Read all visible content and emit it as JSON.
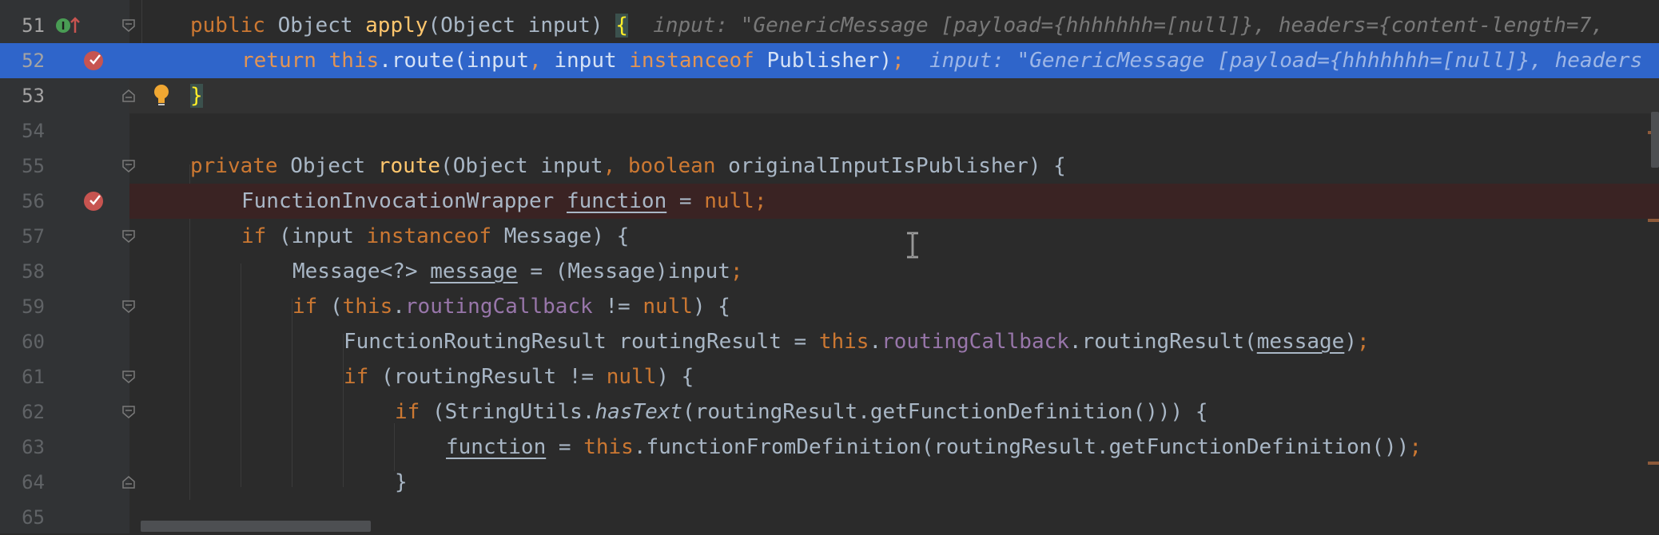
{
  "editor": {
    "lines": [
      {
        "number": "51"
      },
      {
        "number": "52"
      },
      {
        "number": "53"
      },
      {
        "number": "54"
      },
      {
        "number": "55"
      },
      {
        "number": "56"
      },
      {
        "number": "57"
      },
      {
        "number": "58"
      },
      {
        "number": "59"
      },
      {
        "number": "60"
      },
      {
        "number": "61"
      },
      {
        "number": "62"
      },
      {
        "number": "63"
      },
      {
        "number": "64"
      },
      {
        "number": "65"
      }
    ],
    "l51": {
      "kw_public": "public",
      "t_object": " Object ",
      "fn_apply": "apply",
      "t_params": "(Object input) ",
      "brace": "{",
      "hint": "input: \"GenericMessage [payload={hhhhhhh=[null]}, headers={content-length=7, "
    },
    "l52": {
      "kw_return": "return",
      "sp": " ",
      "kw_this": "this",
      "t_route": ".route(input",
      "comma": ",",
      "t_input": " input ",
      "kw_instanceof": "instanceof",
      "t_publisher": " Publisher)",
      "semi": ";",
      "hint": "input: \"GenericMessage [payload={hhhhhhh=[null]}, headers"
    },
    "l53": {
      "brace": "}"
    },
    "l55": {
      "kw_private": "private",
      "t_object": " Object ",
      "fn_route": "route",
      "t_open": "(Object input",
      "comma": ",",
      "sp": " ",
      "kw_boolean": "boolean",
      "t_rest": " originalInputIsPublisher) {"
    },
    "l56": {
      "t_type": "FunctionInvocationWrapper ",
      "v_function": "function",
      "t_eq": " = ",
      "kw_null": "null",
      "semi": ";"
    },
    "l57": {
      "kw_if": "if",
      "t_open": " (input ",
      "kw_instanceof": "instanceof",
      "t_rest": " Message) {"
    },
    "l58": {
      "t_type": "Message<?> ",
      "v_message": "message",
      "t_rest": " = (Message)input",
      "semi": ";"
    },
    "l59": {
      "kw_if": "if",
      "t_open": " (",
      "kw_this": "this",
      "dot": ".",
      "f_callback": "routingCallback",
      "t_neq": " != ",
      "kw_null": "null",
      "t_rest": ") {"
    },
    "l60": {
      "t_type": "FunctionRoutingResult routingResult = ",
      "kw_this": "this",
      "dot": ".",
      "f_callback": "routingCallback",
      "t_call": ".routingResult(",
      "v_message": "message",
      "t_close": ")",
      "semi": ";"
    },
    "l61": {
      "kw_if": "if",
      "t_open": " (routingResult != ",
      "kw_null": "null",
      "t_rest": ") {"
    },
    "l62": {
      "kw_if": "if",
      "t_open": " (StringUtils.",
      "m_hastext": "hasText",
      "t_rest": "(routingResult.getFunctionDefinition())) {"
    },
    "l63": {
      "v_function": "function",
      "t_eq": " = ",
      "kw_this": "this",
      "t_rest": ".functionFromDefinition(routingResult.getFunctionDefinition())",
      "semi": ";"
    },
    "l64": {
      "brace": "}"
    }
  },
  "colors": {
    "background": "#2b2b2b",
    "gutter": "#313335",
    "execution_line": "#2f65ca",
    "breakpoint_line": "#3a2323",
    "keyword": "#cc7832",
    "method": "#ffc66d",
    "field": "#9876aa",
    "text": "#a9b7c6"
  },
  "icons": {
    "line51_gutter": "implements-up-arrow-icon",
    "breakpoint": "breakpoint-verified-icon",
    "bulb": "intention-bulb-icon",
    "fold": "fold-marker-icon",
    "cursor": "text-cursor-icon"
  }
}
